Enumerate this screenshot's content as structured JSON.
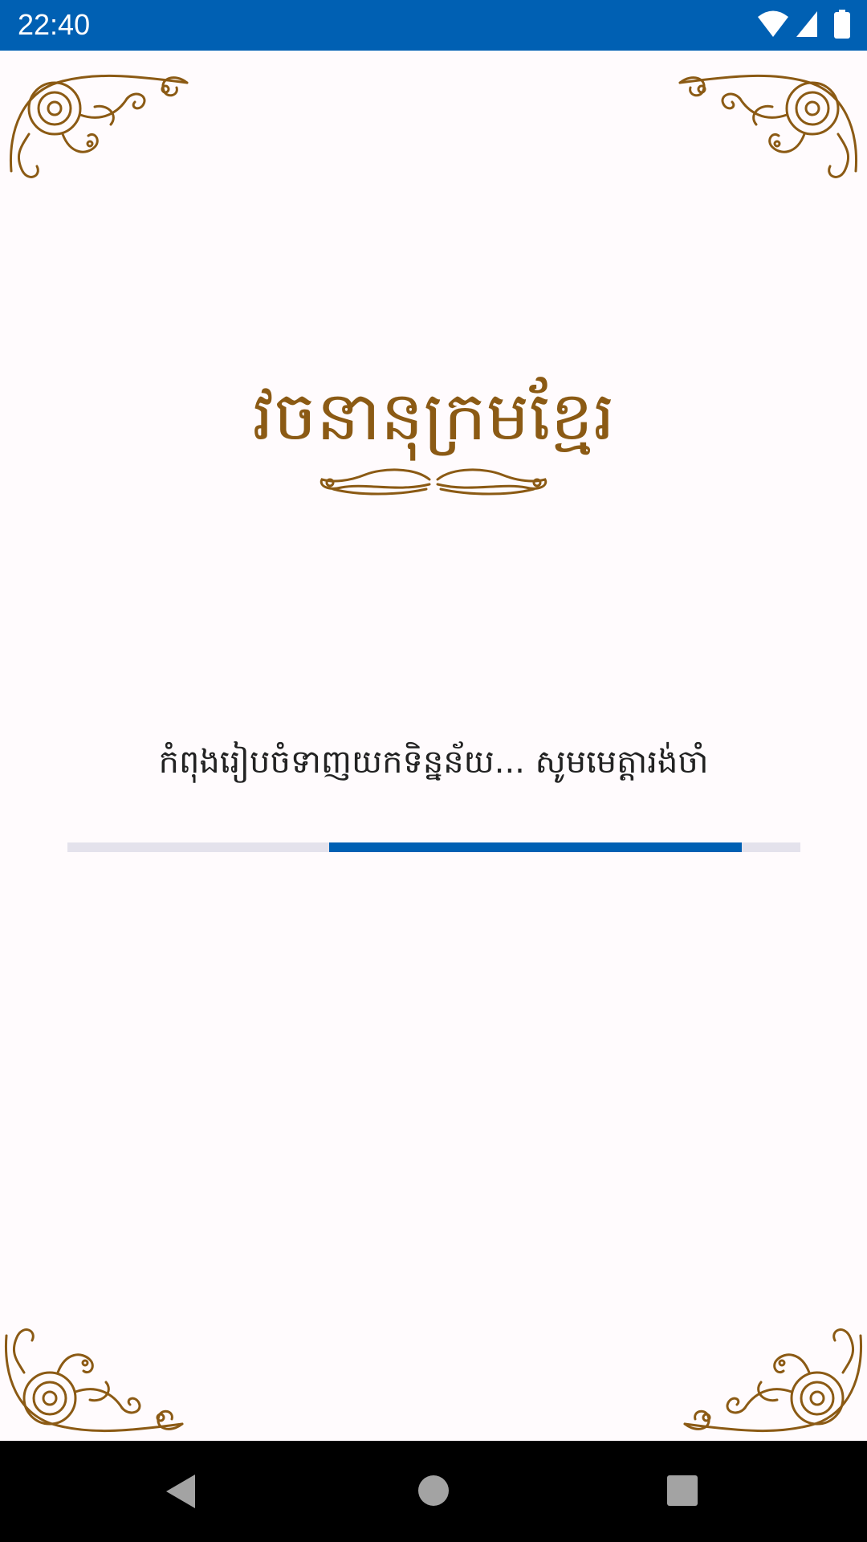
{
  "status_bar": {
    "time": "22:40",
    "icons": [
      "wifi-icon",
      "cellular-signal-icon",
      "battery-icon"
    ],
    "background_color": "#0060b3"
  },
  "splash": {
    "title": "វចនានុក្រមខ្មែរ",
    "loading_text": "កំពុងរៀបចំទាញយកទិន្នន័យ... សូមមេត្តារង់ចាំ",
    "progress_fraction_start": 0.357,
    "progress_fraction_end": 0.92,
    "ornament_color": "#8b5a14",
    "progress_color": "#0060b3",
    "progress_track_color": "#e4e2ec"
  },
  "nav_bar": {
    "buttons": [
      "back-icon",
      "home-icon",
      "recents-icon"
    ]
  }
}
